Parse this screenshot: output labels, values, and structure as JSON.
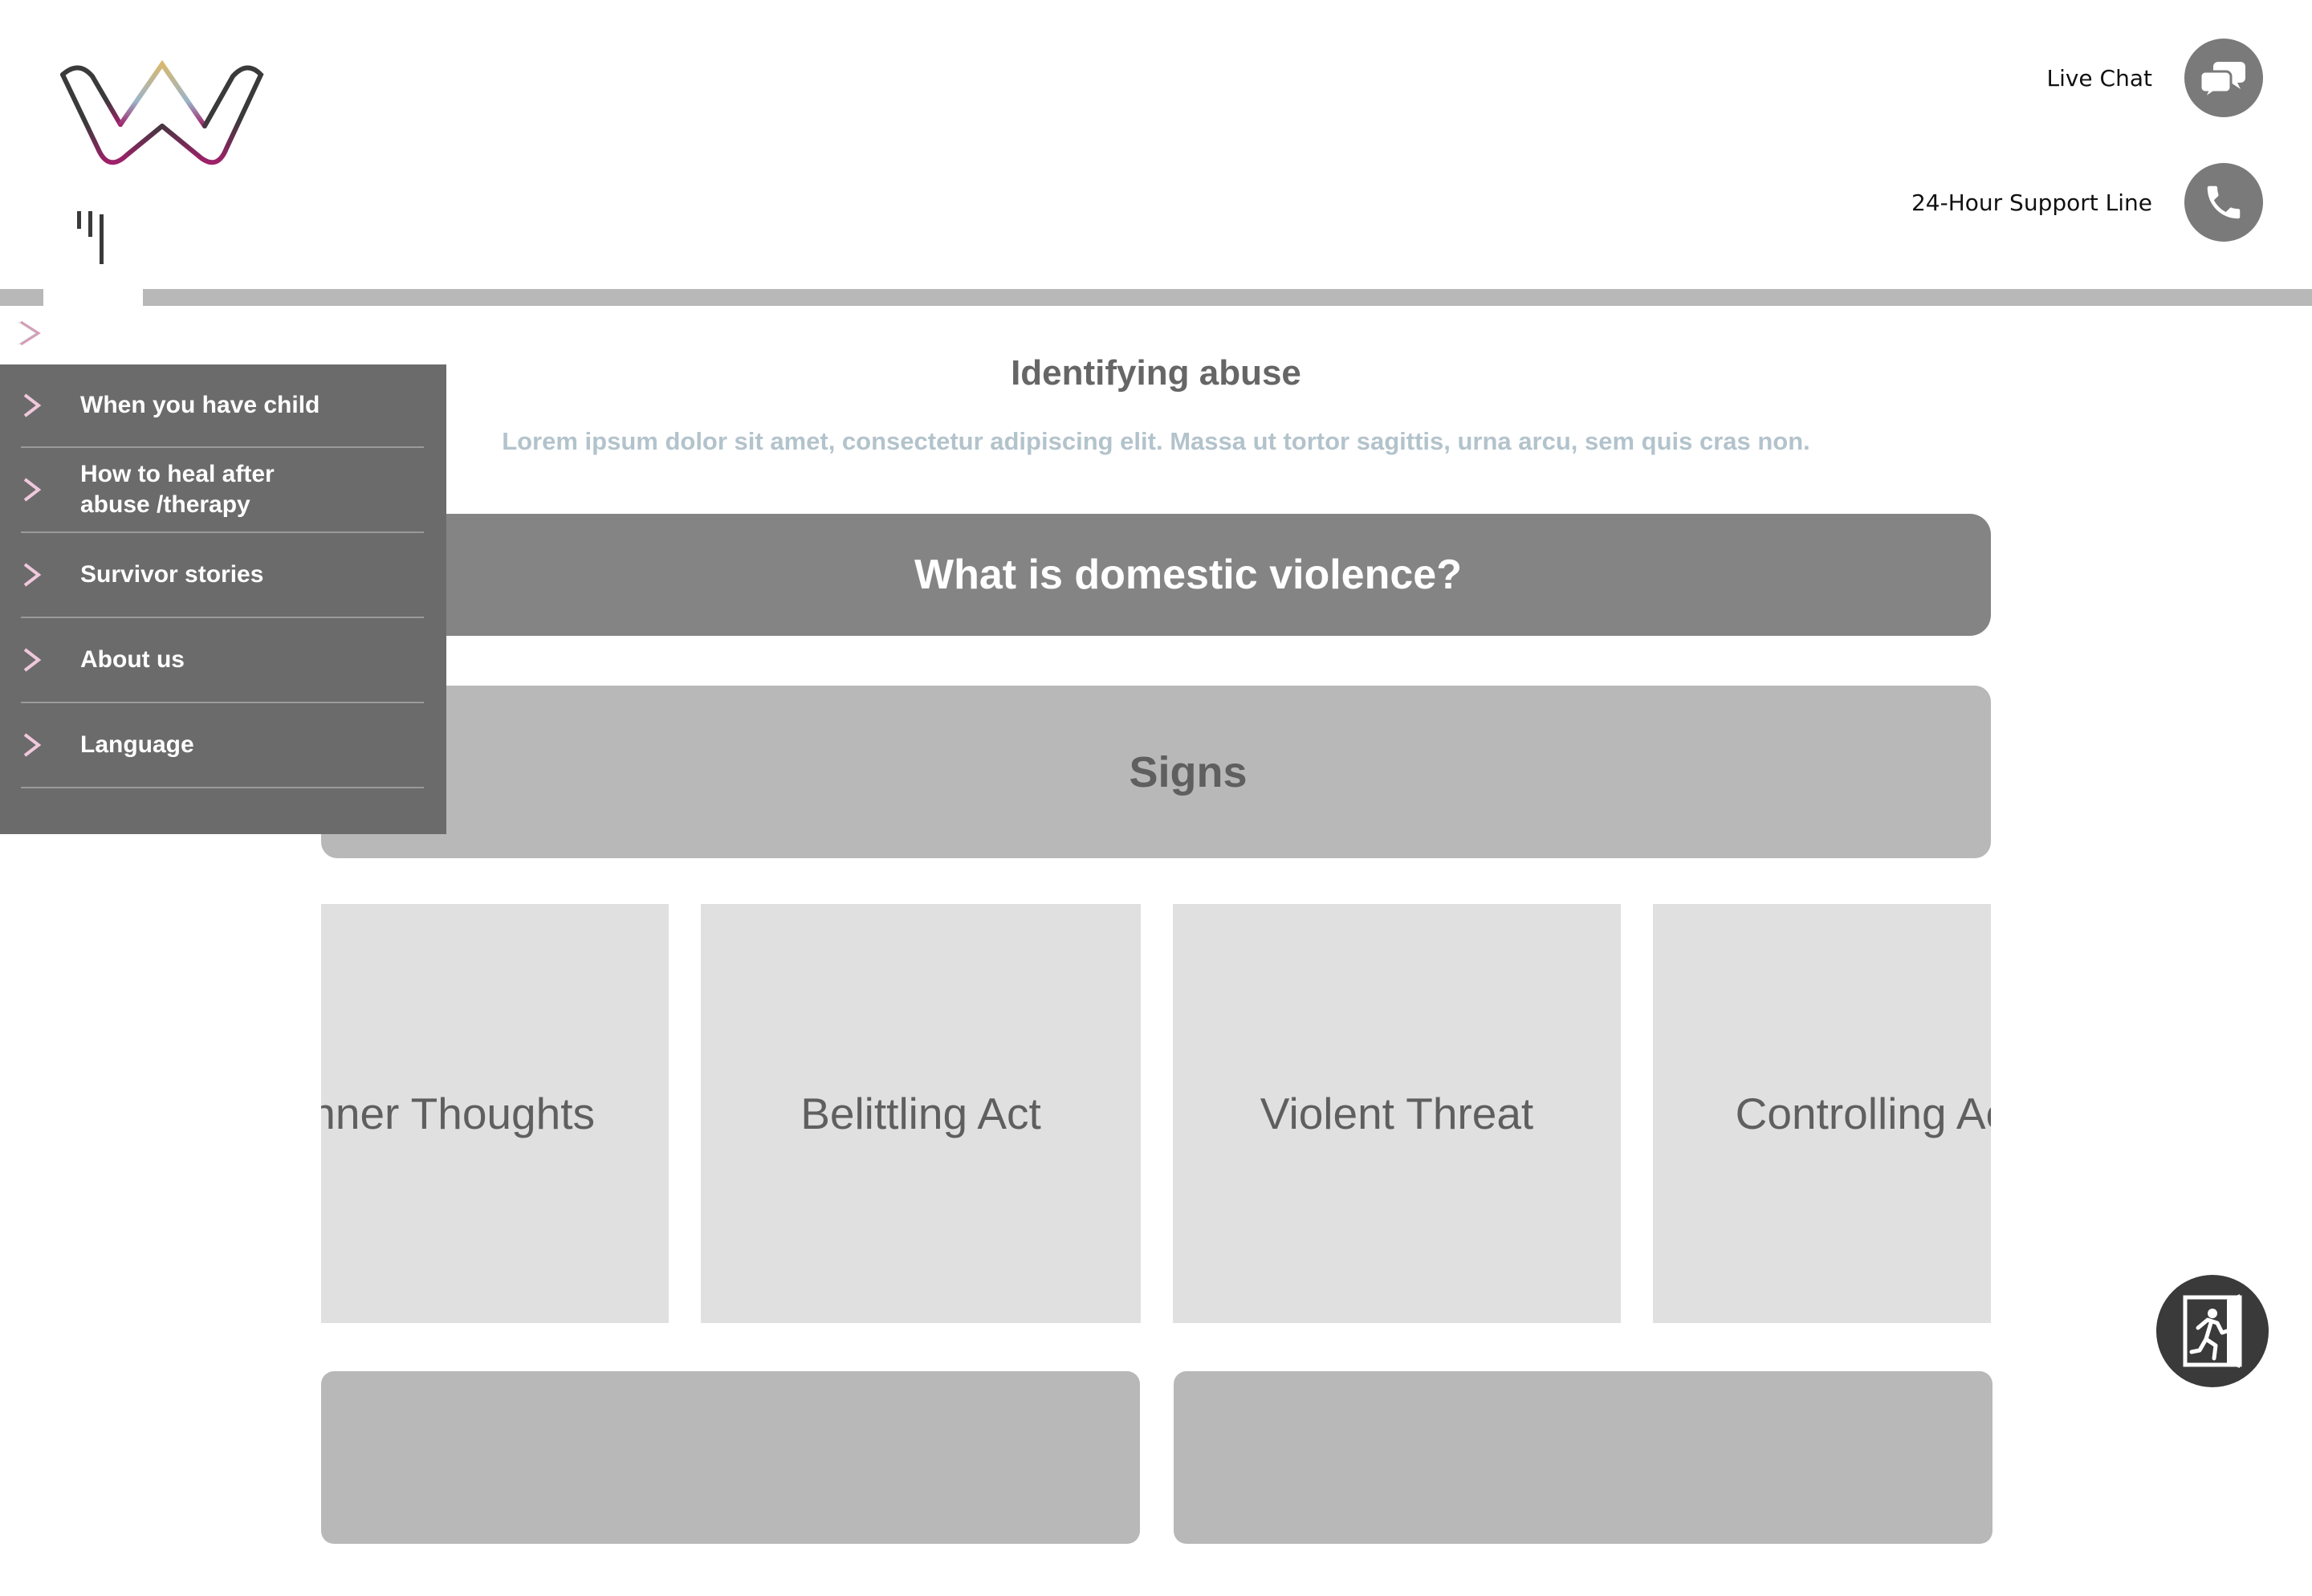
{
  "header": {
    "logo_icon": "w-logo",
    "live_chat": {
      "label": "Live Chat",
      "icon": "chat-bubbles-icon"
    },
    "support_line": {
      "label": "24-Hour Support Line",
      "icon": "phone-icon"
    }
  },
  "menu": {
    "toggle_icon": "chevron-right-icon",
    "items": [
      {
        "label": "When you have child"
      },
      {
        "label": "How to heal after\nabuse /therapy"
      },
      {
        "label": "Survivor stories"
      },
      {
        "label": "About us"
      },
      {
        "label": "Language"
      }
    ]
  },
  "main": {
    "title": "Identifying abuse",
    "description": "Lorem ipsum dolor sit amet, consectetur adipiscing elit. Massa ut tortor sagittis, urna arcu, sem quis cras non.",
    "dv_banner": "What is domestic violence?",
    "signs_banner": "Signs",
    "cards": [
      {
        "label": "Inner Thoughts"
      },
      {
        "label": "Belittling Act"
      },
      {
        "label": "Violent Threat"
      },
      {
        "label": "Controlling Act"
      }
    ]
  },
  "exit_button": {
    "icon": "exit-running-icon"
  },
  "colors": {
    "menu_bg": "#6b6b6b",
    "banner_dark": "#848484",
    "banner_light": "#b8b8b8",
    "card_bg": "#e0e0e0",
    "desc_text": "#b3c3cc",
    "logo_pink": "#a0206a",
    "logo_gold": "#d9b870"
  }
}
